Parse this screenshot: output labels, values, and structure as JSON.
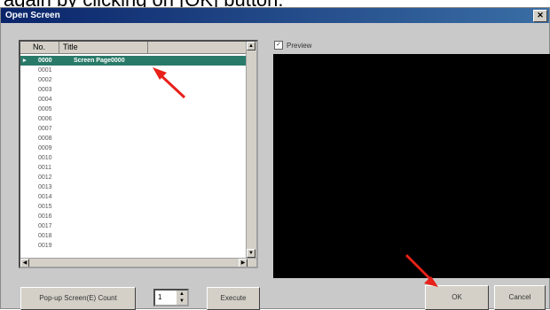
{
  "caption": "again by clicking on [OK] button.",
  "window": {
    "title": "Open Screen"
  },
  "list": {
    "columns": [
      "No.",
      "Title"
    ],
    "rows": [
      {
        "no": "0000",
        "title": "Screen Page0000",
        "selected": true
      },
      {
        "no": "0001",
        "title": ""
      },
      {
        "no": "0002",
        "title": ""
      },
      {
        "no": "0003",
        "title": ""
      },
      {
        "no": "0004",
        "title": ""
      },
      {
        "no": "0005",
        "title": ""
      },
      {
        "no": "0006",
        "title": ""
      },
      {
        "no": "0007",
        "title": ""
      },
      {
        "no": "0008",
        "title": ""
      },
      {
        "no": "0009",
        "title": ""
      },
      {
        "no": "0010",
        "title": ""
      },
      {
        "no": "0011",
        "title": ""
      },
      {
        "no": "0012",
        "title": ""
      },
      {
        "no": "0013",
        "title": ""
      },
      {
        "no": "0014",
        "title": ""
      },
      {
        "no": "0015",
        "title": ""
      },
      {
        "no": "0016",
        "title": ""
      },
      {
        "no": "0017",
        "title": ""
      },
      {
        "no": "0018",
        "title": ""
      },
      {
        "no": "0019",
        "title": ""
      }
    ]
  },
  "preview": {
    "label": "Preview",
    "checked": true
  },
  "buttons": {
    "popup": "Pop-up Screen(E) Count",
    "stepper_value": "1",
    "execute": "Execute",
    "ok": "OK",
    "cancel": "Cancel"
  },
  "colors": {
    "selection": "#2a7a6a",
    "arrow": "#e8201a",
    "title_bar": "#0a246a"
  }
}
